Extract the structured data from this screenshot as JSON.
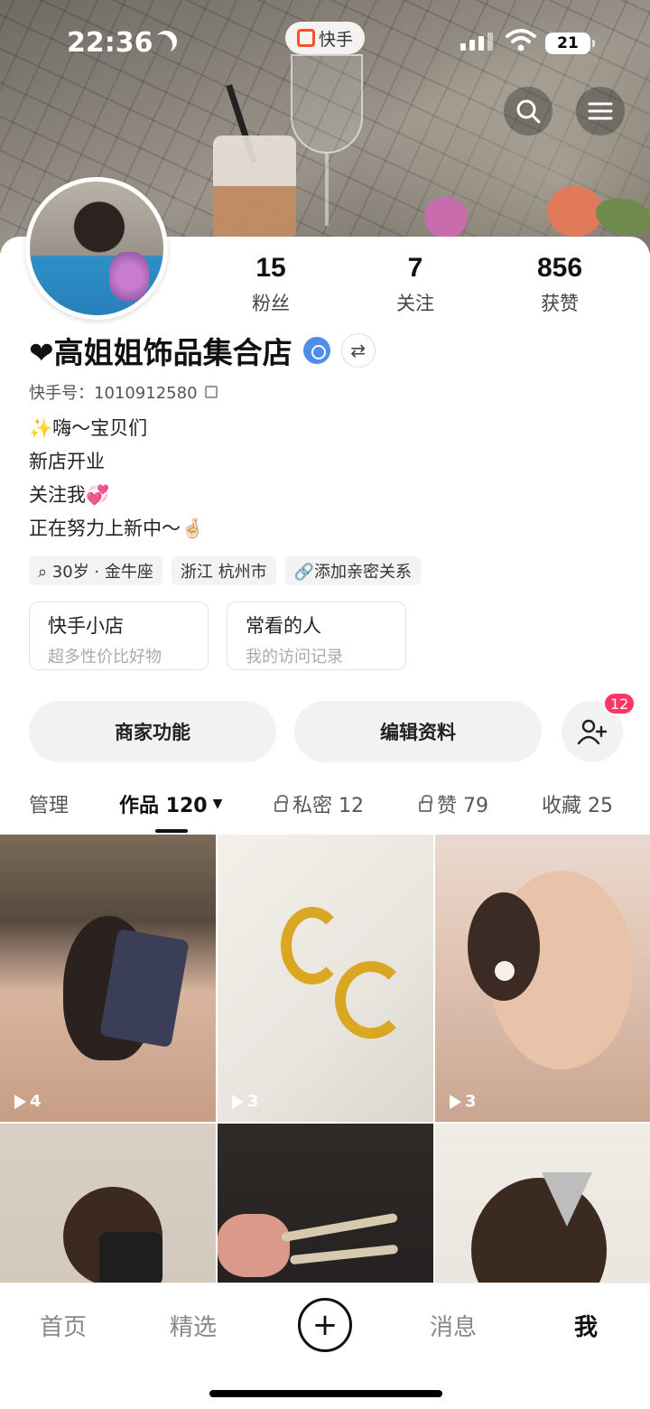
{
  "status": {
    "time": "22:36",
    "app_pill": "快手",
    "battery": "21"
  },
  "stats": [
    {
      "num": "15",
      "label": "粉丝"
    },
    {
      "num": "7",
      "label": "关注"
    },
    {
      "num": "856",
      "label": "获赞"
    }
  ],
  "profile": {
    "name": "❤高姐姐饰品集合店",
    "ks_id": "快手号：1010912580",
    "bio": [
      "✨嗨～宝贝们",
      "新店开业",
      "关注我💞",
      "正在努力上新中～🤞🏻"
    ],
    "tags": [
      "⌕ 30岁 · 金牛座",
      "浙江 杭州市",
      "🔗添加亲密关系"
    ]
  },
  "cards": [
    {
      "title": "快手小店",
      "sub": "超多性价比好物"
    },
    {
      "title": "常看的人",
      "sub": "我的访问记录"
    }
  ],
  "actions": {
    "merchant": "商家功能",
    "edit": "编辑资料",
    "add_friend_badge": "12"
  },
  "tabs": {
    "manage": "管理",
    "works": "作品 120",
    "private": "私密 12",
    "likes": "赞 79",
    "favorites": "收藏 25"
  },
  "grid": [
    {
      "count": "4"
    },
    {
      "count": "3"
    },
    {
      "count": "3"
    },
    {
      "count": ""
    },
    {
      "count": ""
    },
    {
      "count": ""
    }
  ],
  "nav": {
    "home": "首页",
    "featured": "精选",
    "messages": "消息",
    "me": "我"
  }
}
